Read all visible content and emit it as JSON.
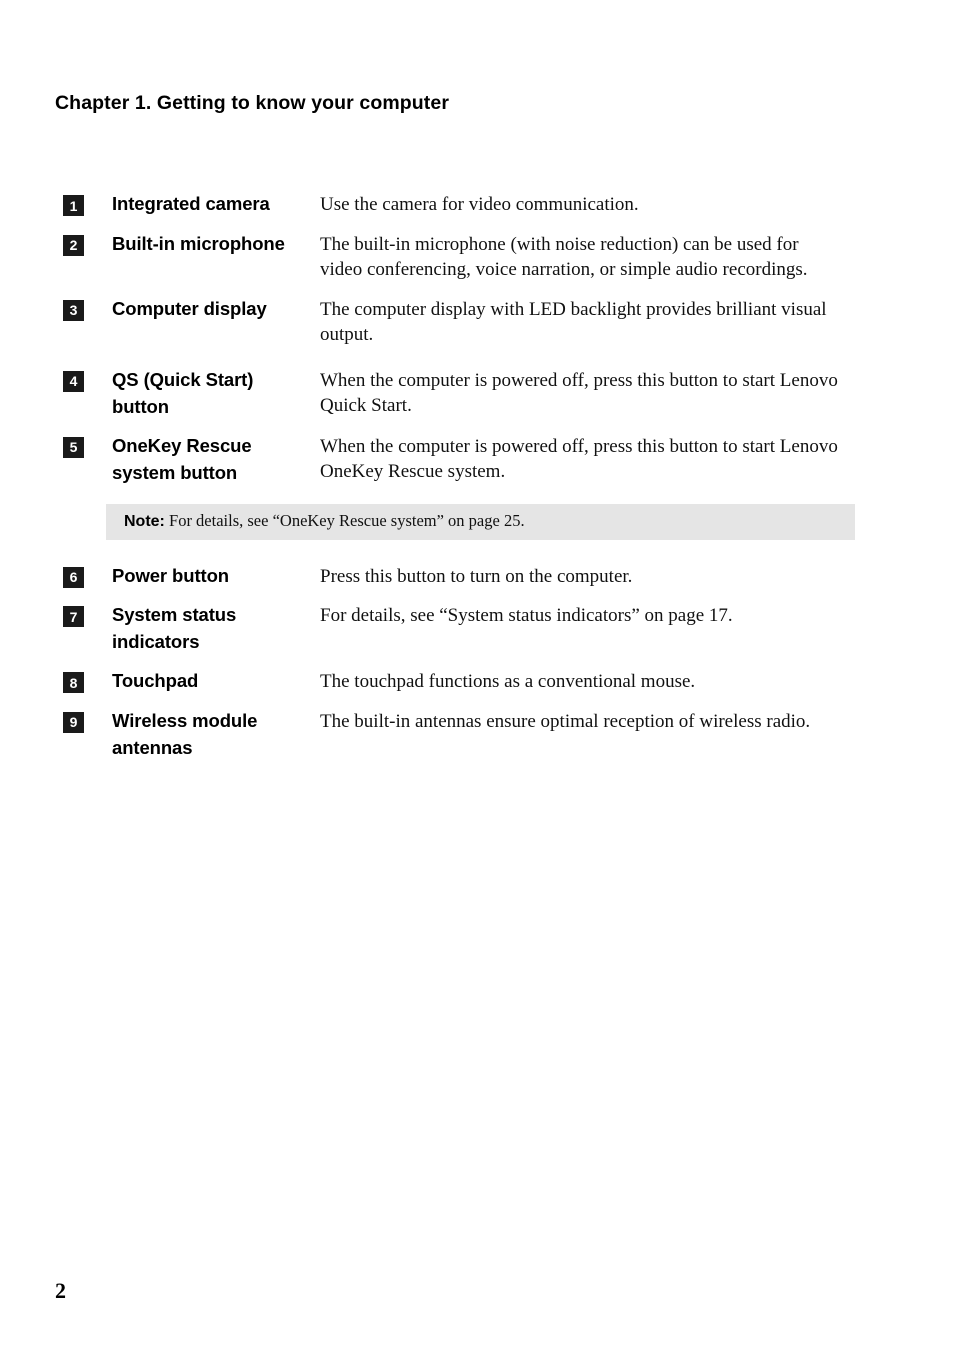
{
  "document": {
    "chapter_heading": "Chapter 1. Getting to know your computer",
    "page_number": "2"
  },
  "features": [
    {
      "number": "1",
      "label": "Integrated camera",
      "description": "Use the camera for video communication."
    },
    {
      "number": "2",
      "label": "Built-in microphone",
      "description": "The built-in microphone (with noise reduction) can be used for video conferencing, voice narration, or simple audio recordings."
    },
    {
      "number": "3",
      "label": "Computer display",
      "description": "The computer display with LED backlight provides brilliant visual output."
    },
    {
      "number": "4",
      "label": "QS (Quick Start) button",
      "description": "When the computer is powered off, press this button to start Lenovo Quick Start."
    },
    {
      "number": "5",
      "label": "OneKey Rescue system button",
      "description": "When the computer is powered off, press this button to start Lenovo OneKey Rescue system."
    },
    {
      "number": "6",
      "label": "Power button",
      "description": "Press this button to turn on the computer."
    },
    {
      "number": "7",
      "label": "System status indicators",
      "description": "For details, see “System status indicators” on page 17."
    },
    {
      "number": "8",
      "label": "Touchpad",
      "description": "The touchpad functions as a conventional mouse."
    },
    {
      "number": "9",
      "label": "Wireless module antennas",
      "description": "The built-in antennas ensure optimal reception of wireless radio."
    }
  ],
  "note": {
    "label": "Note:",
    "text": " For details, see “OneKey Rescue system” on page 25.",
    "background_color": "#e5e5e5"
  },
  "colors": {
    "badge_background": "#1a1a1a",
    "badge_text": "#ffffff",
    "body_text": "#111111",
    "heading_text": "#000000",
    "page_background": "#ffffff"
  }
}
